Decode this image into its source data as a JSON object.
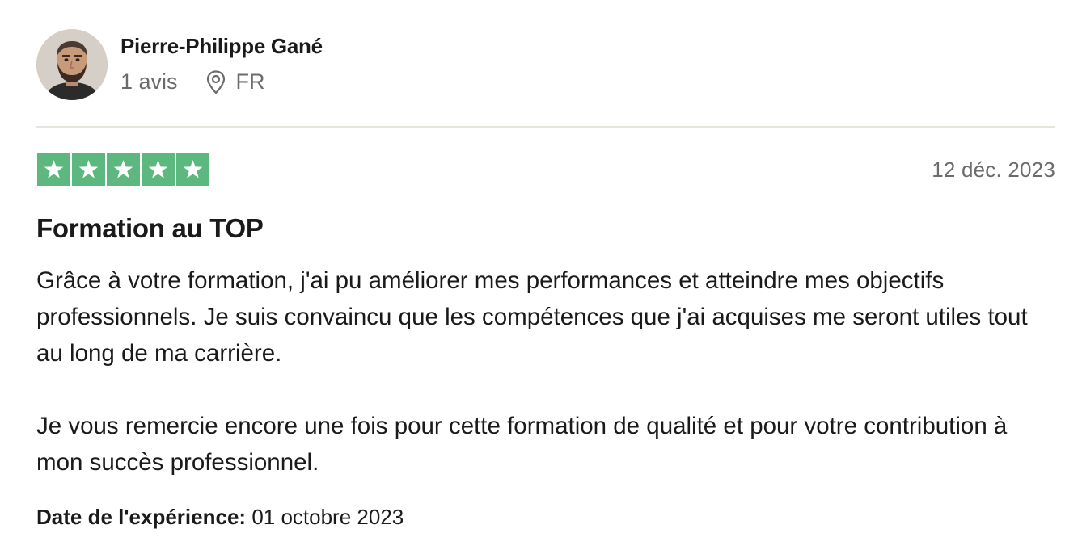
{
  "reviewer": {
    "name": "Pierre-Philippe Gané",
    "review_count": "1 avis",
    "country": "FR",
    "location_icon": "location-pin-icon"
  },
  "review": {
    "rating": 5,
    "rating_max": 5,
    "star_color": "#5cb87f",
    "date": "12 déc. 2023",
    "title": "Formation au TOP",
    "paragraphs": [
      "Grâce à votre formation, j'ai pu améliorer mes performances et atteindre mes objectifs professionnels. Je suis convaincu que les compétences que j'ai acquises me seront utiles tout au long de ma carrière.",
      "Je vous remercie encore une fois pour cette formation de qualité et pour votre contribution à mon succès professionnel."
    ],
    "experience_label": "Date de l'expérience:",
    "experience_date": "01 octobre 2023"
  }
}
